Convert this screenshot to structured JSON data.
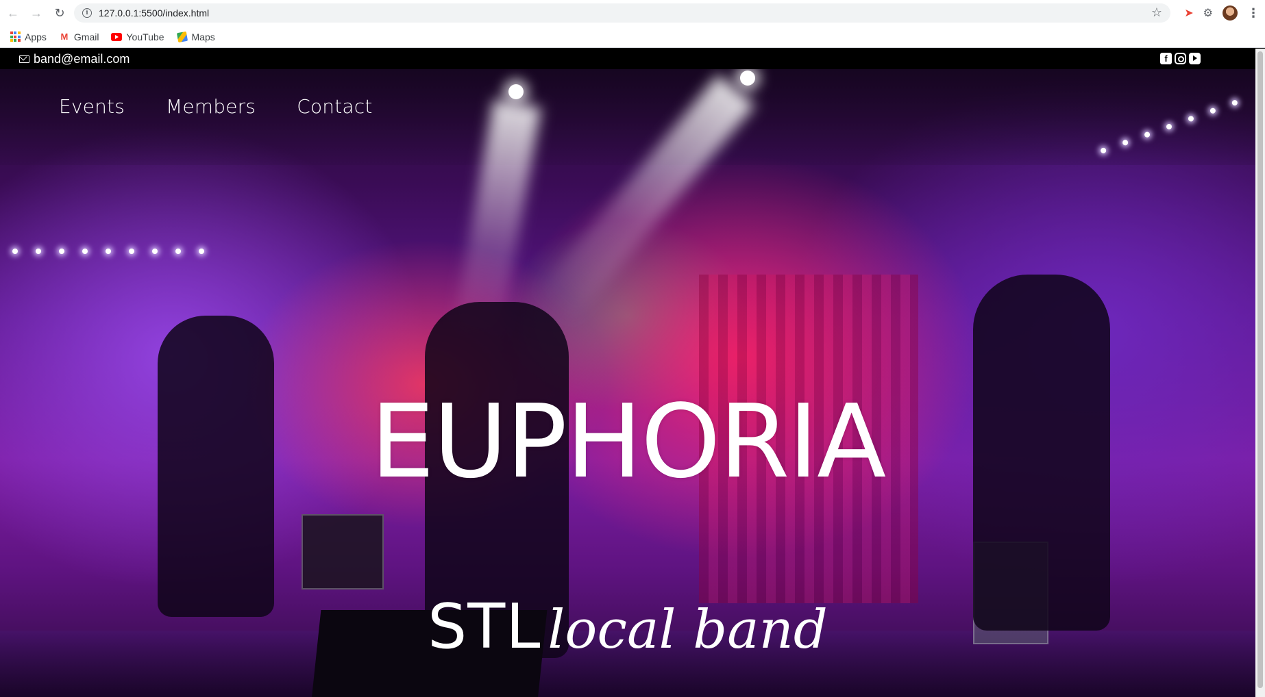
{
  "browser": {
    "url": "127.0.0.1:5500/index.html",
    "bookmarks": [
      {
        "label": "Apps",
        "icon": "apps-grid-icon"
      },
      {
        "label": "Gmail",
        "icon": "gmail-icon"
      },
      {
        "label": "YouTube",
        "icon": "youtube-icon"
      },
      {
        "label": "Maps",
        "icon": "maps-icon"
      }
    ]
  },
  "topbar": {
    "email": "band@email.com",
    "social": [
      "facebook-icon",
      "instagram-icon",
      "youtube-icon"
    ]
  },
  "nav": {
    "items": [
      {
        "label": "Events"
      },
      {
        "label": "Members"
      },
      {
        "label": "Contact"
      }
    ]
  },
  "hero": {
    "title": "EUPHORIA",
    "tagline_prefix": "STL",
    "tagline_script": "local band"
  },
  "colors": {
    "topbar_bg": "#000000",
    "text": "#ffffff",
    "hero_purple": "#7d1ea4",
    "hero_pink": "#ff286e"
  }
}
